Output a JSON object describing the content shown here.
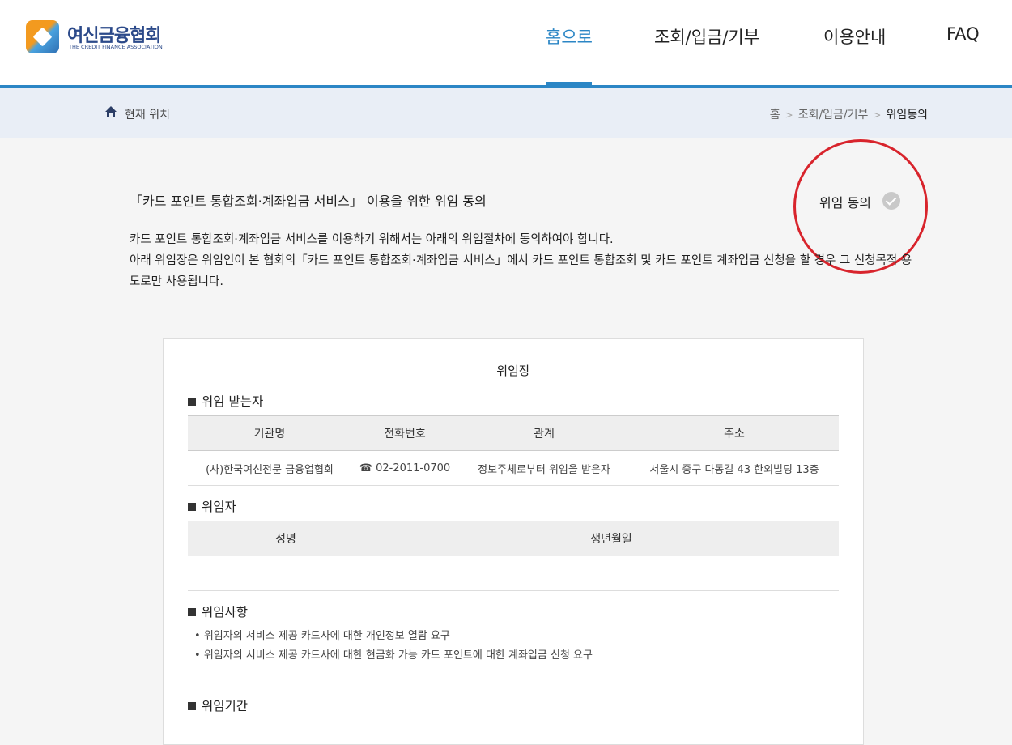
{
  "header": {
    "logo_kr": "여신금융협회",
    "logo_en": "THE CREDIT FINANCE ASSOCIATION",
    "nav": [
      "홈으로",
      "조회/입금/기부",
      "이용안내",
      "FAQ"
    ],
    "active_nav": 0,
    "accent_color": "#2b86c5"
  },
  "breadcrumb": {
    "label": "현재 위치",
    "items": [
      "홈",
      "조회/입금/기부",
      "위임동의"
    ],
    "separator": ">"
  },
  "intro": {
    "title": "「카드 포인트 통합조회·계좌입금 서비스」 이용을 위한 위임 동의",
    "consent_label": "위임 동의",
    "consent_checked": false,
    "line1": "카드 포인트 통합조회·계좌입금 서비스를 이용하기 위해서는 아래의 위임절차에 동의하여야 합니다.",
    "line2": "아래 위임장은 위임인이 본 협회의「카드 포인트 통합조회·계좌입금 서비스」에서 카드 포인트 통합조회 및 카드 포인트 계좌입금 신청을 할 경우 그 신청목적 용도로만 사용됩니다."
  },
  "document": {
    "title": "위임장",
    "recipient": {
      "heading": "위임 받는자",
      "columns": [
        "기관명",
        "전화번호",
        "관계",
        "주소"
      ],
      "row": [
        "(사)한국여신전문 금융업협회",
        "☎ 02-2011-0700",
        "정보주체로부터 위임을 받은자",
        "서울시 중구 다동길 43 한외빌딩 13층"
      ]
    },
    "delegator": {
      "heading": "위임자",
      "columns": [
        "성명",
        "생년월일"
      ]
    },
    "matters": {
      "heading": "위임사항",
      "items": [
        "위임자의 서비스 제공 카드사에 대한 개인정보 열람 요구",
        "위임자의 서비스 제공 카드사에 대한 현금화 가능 카드 포인트에 대한 계좌입금 신청 요구"
      ]
    },
    "period": {
      "heading": "위임기간"
    }
  }
}
